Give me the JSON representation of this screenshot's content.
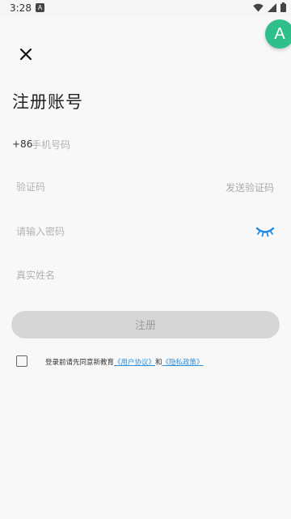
{
  "status_bar": {
    "time": "3:28",
    "app_icon_letter": "A"
  },
  "floating_badge": {
    "letter": "A"
  },
  "page": {
    "title": "注册账号"
  },
  "form": {
    "phone_prefix": "+86",
    "phone_placeholder": "手机号码",
    "code_placeholder": "验证码",
    "send_code_label": "发送验证码",
    "password_placeholder": "请输入密码",
    "name_placeholder": "真实姓名",
    "register_label": "注册"
  },
  "agreement": {
    "prefix": "登录前请先同意新教育",
    "user_agreement": "《用户协议》",
    "and": "和",
    "privacy_policy": "《隐私政策》"
  },
  "colors": {
    "accent": "#2f8fd8",
    "badge": "#2fbf8a",
    "button_disabled": "#d6d6d6"
  },
  "icons": [
    "close-icon",
    "eye-closed-icon",
    "wifi-icon",
    "signal-icon",
    "battery-icon"
  ]
}
